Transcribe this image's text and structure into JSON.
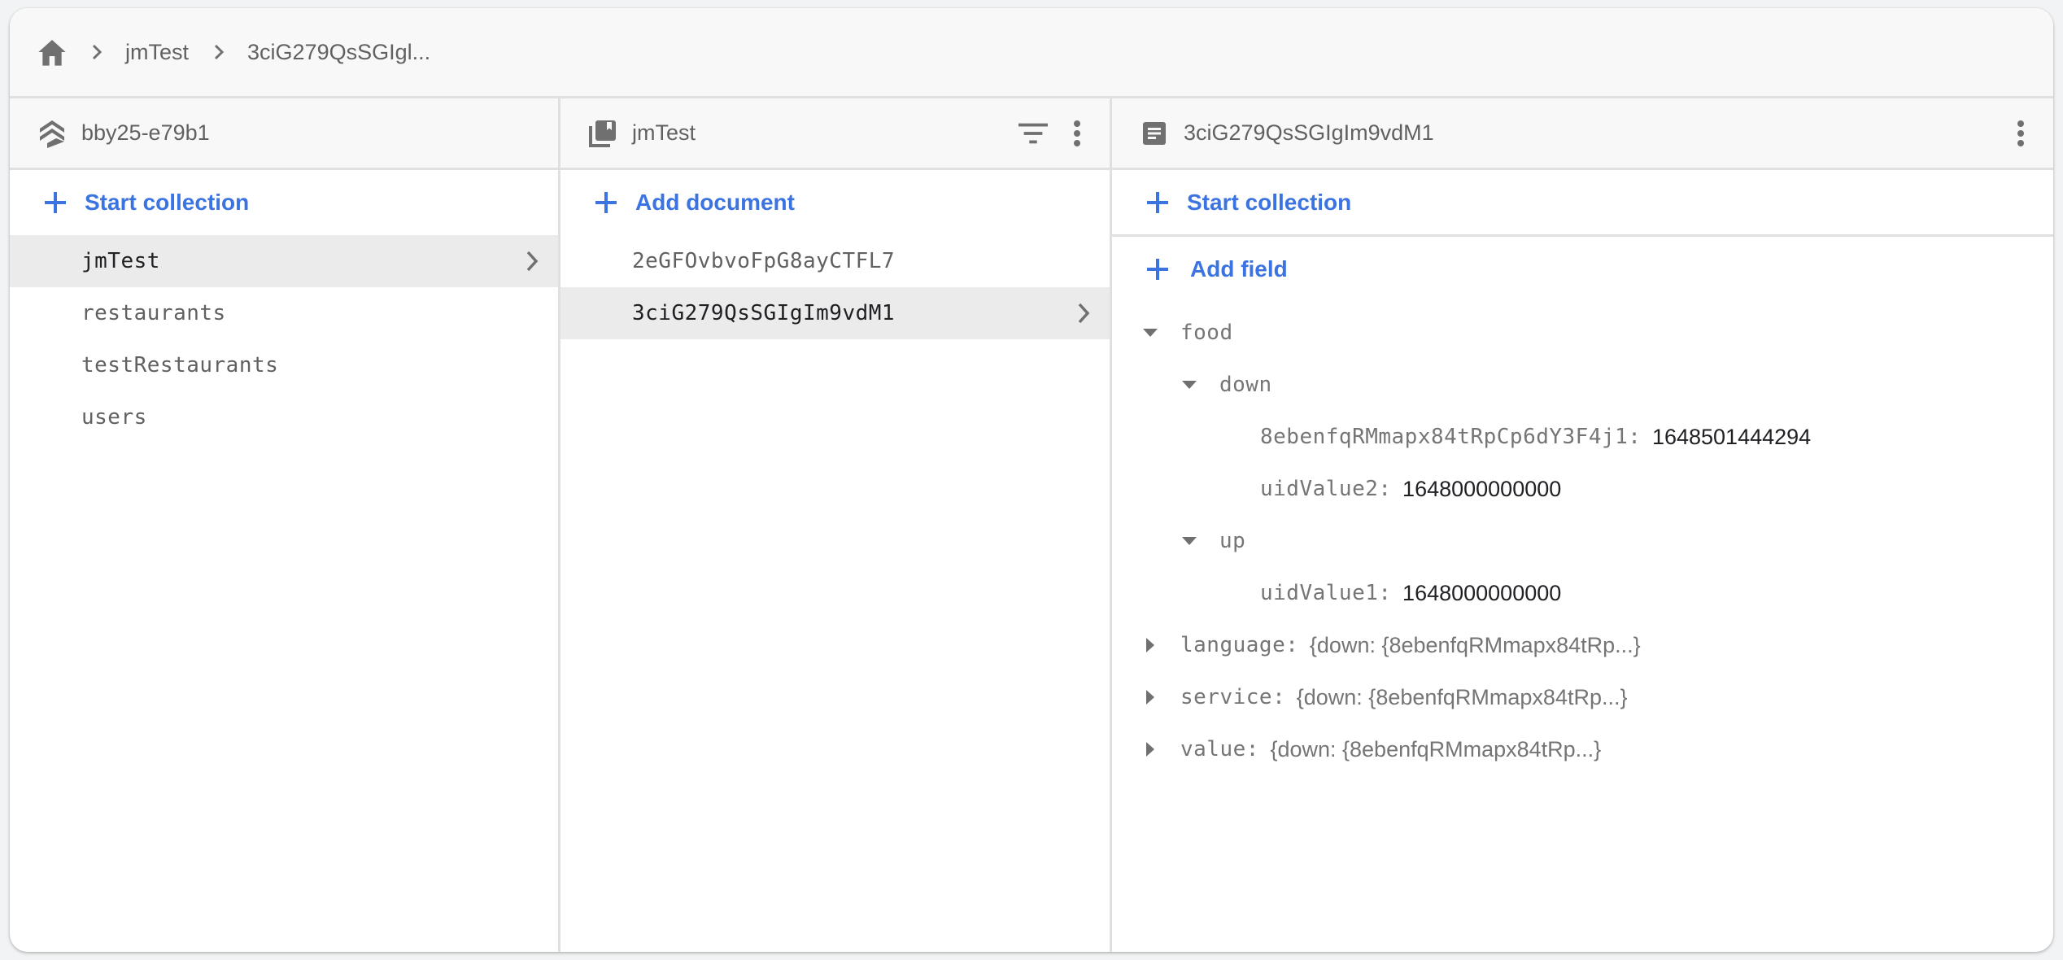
{
  "breadcrumb": {
    "home_icon": "home-icon",
    "items": [
      "jmTest",
      "3ciG279QsSGIgl..."
    ]
  },
  "columns": {
    "root": {
      "icon": "firestore-stack-icon",
      "title": "bby25-e79b1",
      "add_label": "Start collection",
      "items": [
        {
          "label": "jmTest",
          "selected": true
        },
        {
          "label": "restaurants",
          "selected": false
        },
        {
          "label": "testRestaurants",
          "selected": false
        },
        {
          "label": "users",
          "selected": false
        }
      ]
    },
    "collection": {
      "icon": "collection-icon",
      "title": "jmTest",
      "filter_icon": "filter-icon",
      "more_icon": "more-vert-icon",
      "add_label": "Add document",
      "items": [
        {
          "label": "2eGFOvbvoFpG8ayCTFL7",
          "selected": false
        },
        {
          "label": "3ciG279QsSGIgIm9vdM1",
          "selected": true
        }
      ]
    },
    "document": {
      "icon": "document-icon",
      "title": "3ciG279QsSGIgIm9vdM1",
      "more_icon": "more-vert-icon",
      "start_collection_label": "Start collection",
      "add_field_label": "Add field",
      "fields": {
        "food": {
          "key": "food",
          "expanded": true,
          "down": {
            "key": "down",
            "expanded": true,
            "entries": [
              {
                "key": "8ebenfqRMmapx84tRpCp6dY3F4j1",
                "value": "1648501444294"
              },
              {
                "key": "uidValue2",
                "value": "1648000000000"
              }
            ]
          },
          "up": {
            "key": "up",
            "expanded": true,
            "entries": [
              {
                "key": "uidValue1",
                "value": "1648000000000"
              }
            ]
          }
        },
        "collapsed": [
          {
            "key": "language",
            "preview": "{down: {8ebenfqRMmapx84tRp...}"
          },
          {
            "key": "service",
            "preview": "{down: {8ebenfqRMmapx84tRp...}"
          },
          {
            "key": "value",
            "preview": "{down: {8ebenfqRMmapx84tRp...}"
          }
        ]
      }
    }
  },
  "colors": {
    "accent": "#3b73e0",
    "icon": "#707070",
    "selected_bg": "#ebebeb",
    "header_bg": "#f8f8f8"
  }
}
